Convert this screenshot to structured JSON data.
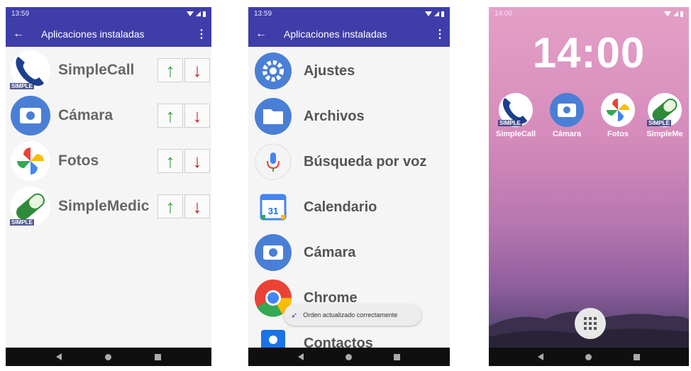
{
  "phone1": {
    "status_time": "13:59",
    "status_icons": "• B",
    "title": "Aplicaciones instaladas",
    "apps": [
      {
        "label": "SimpleCall",
        "icon": "simplecall-icon",
        "tag": "SIMPLE"
      },
      {
        "label": "Cámara",
        "icon": "camera-icon"
      },
      {
        "label": "Fotos",
        "icon": "photos-icon"
      },
      {
        "label": "SimpleMedic",
        "icon": "simplemedic-icon",
        "tag": "SIMPLE"
      }
    ],
    "up_glyph": "↑",
    "down_glyph": "↓"
  },
  "phone2": {
    "status_time": "13:59",
    "title": "Aplicaciones instaladas",
    "apps": [
      {
        "label": "Ajustes",
        "icon": "settings-icon"
      },
      {
        "label": "Archivos",
        "icon": "folder-icon"
      },
      {
        "label": "Búsqueda por voz",
        "icon": "microphone-icon"
      },
      {
        "label": "Calendario",
        "icon": "calendar-icon",
        "day": "31"
      },
      {
        "label": "Cámara",
        "icon": "camera-icon"
      },
      {
        "label": "Chrome",
        "icon": "chrome-icon"
      },
      {
        "label": "Contactos",
        "icon": "contacts-icon"
      }
    ],
    "toast": "Orden actualizado correctamente"
  },
  "phone3": {
    "status_time": "14:00",
    "clock": "14:00",
    "apps": [
      {
        "label": "SimpleCall",
        "icon": "simplecall-icon",
        "tag": "SIMPLE"
      },
      {
        "label": "Cámara",
        "icon": "camera-icon"
      },
      {
        "label": "Fotos",
        "icon": "photos-icon"
      },
      {
        "label": "SimpleMe",
        "icon": "simplemedic-icon",
        "tag": "SIMPLE"
      }
    ]
  },
  "colors": {
    "appbar": "#3f3daa",
    "up": "#2e9a3a",
    "down": "#c42020",
    "google_blue": "#4a7fd6"
  }
}
